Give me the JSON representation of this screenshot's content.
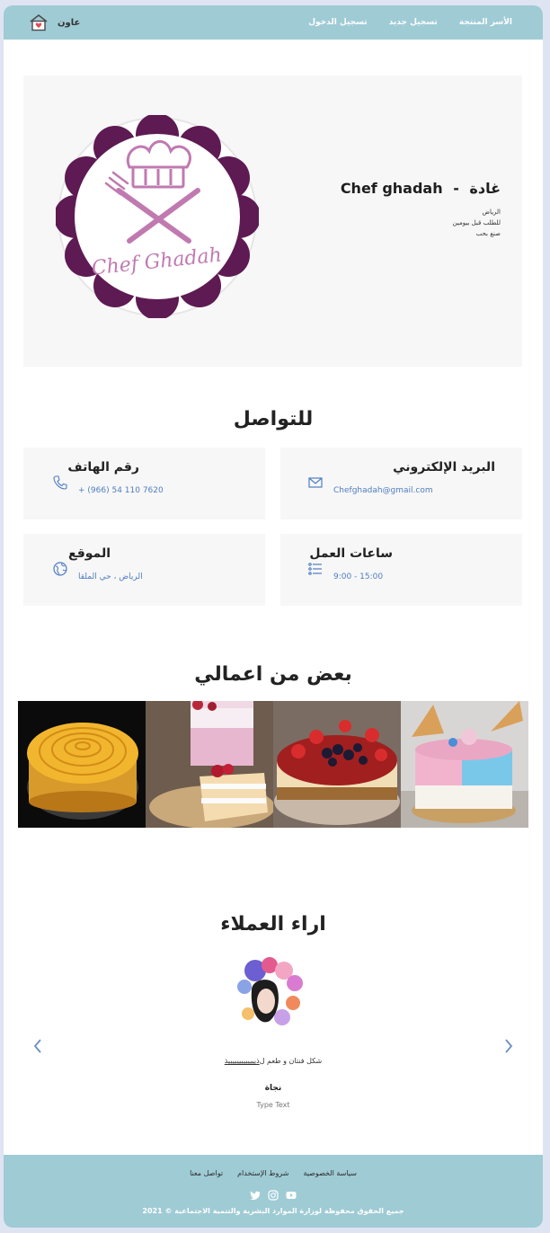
{
  "header": {
    "brand": "عاون",
    "nav": [
      "الأسر المنتجة",
      "تسجيل جديد",
      "تسجيل الدخول"
    ]
  },
  "hero": {
    "logo_text": "Chef Ghadah",
    "name_ar": "غادة",
    "separator": "-",
    "name_en": "Chef ghadah",
    "lines": [
      "الرياض",
      "للطلب قبل بيومين",
      "صنع بحب"
    ]
  },
  "contact": {
    "title": "للتواصل",
    "cards": {
      "email": {
        "label": "البريد الإلكتروني",
        "value": "Chefghadah@gmail.com",
        "icon": "envelope-icon"
      },
      "phone": {
        "label": "رقم الهاتف",
        "value": "+ (966) 54 110 7620",
        "icon": "phone-icon"
      },
      "hours": {
        "label": "ساعات العمل",
        "value": "9:00 - 15:00",
        "icon": "list-icon"
      },
      "location": {
        "label": "الموقع",
        "value": "الرياض ، حي الملقا",
        "icon": "globe-icon"
      }
    }
  },
  "works": {
    "title": "بعض من اعمالي",
    "photos": [
      "mango-rose-cake",
      "layered-berry-cake",
      "berry-cheesecake",
      "ice-cream-drip-cake"
    ]
  },
  "reviews": {
    "title": "اراء العملاء",
    "text_prefix": "شكل فنتان و طعم ل",
    "text_underlined": "ذيييييييييييييذ",
    "name": "نجاة",
    "role": "Type Text"
  },
  "footer": {
    "links": [
      "سياسة الخصوصية",
      "شروط الإستخدام",
      "تواصل معنا"
    ],
    "social": [
      "twitter-icon",
      "instagram-icon",
      "youtube-icon"
    ],
    "copyright": "جميع الحقوق محفوظة لوزارة الموارد البشرية والتنمية الاجتماعية © 2021"
  },
  "colors": {
    "header_bg": "#9fcbd5",
    "accent_blue": "#4f7dc1",
    "logo_purple": "#5e1a52",
    "logo_pink": "#c07ab0"
  }
}
